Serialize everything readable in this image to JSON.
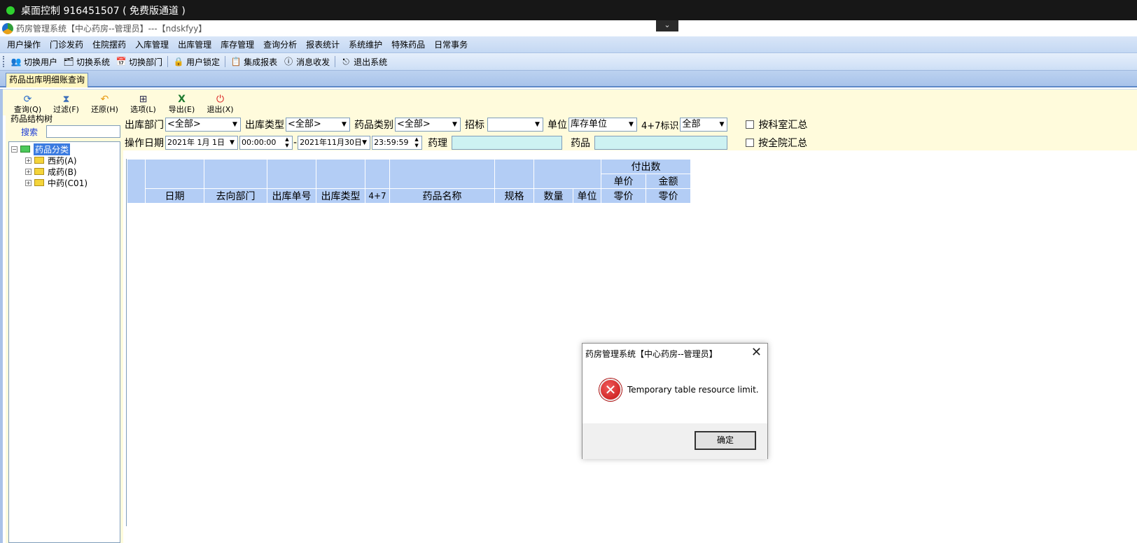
{
  "remote_bar": {
    "title": "桌面控制 916451507 ( 免费版通道 )",
    "chevron": "⌄"
  },
  "window": {
    "title": "药房管理系统【中心药房--管理员】---【ndskfyy】"
  },
  "menu": [
    "用户操作",
    "门诊发药",
    "住院摆药",
    "入库管理",
    "出库管理",
    "库存管理",
    "查询分析",
    "报表统计",
    "系统维护",
    "特殊药品",
    "日常事务"
  ],
  "toolbar": {
    "switch_user": "切换用户",
    "switch_system": "切换系统",
    "switch_dept": "切换部门",
    "user_lock": "用户锁定",
    "integrated_report": "集成报表",
    "messages": "消息收发",
    "exit_system": "退出系统"
  },
  "tab": {
    "label": "药品出库明细账查询"
  },
  "iconbar": {
    "query": "查询(Q)",
    "filter": "过滤(F)",
    "restore": "还原(H)",
    "options": "选项(L)",
    "export": "导出(E)",
    "exit": "退出(X)"
  },
  "left_panel": {
    "title": "药品结构树",
    "search_label": "搜索",
    "search_value": "",
    "tree_root": "药品分类",
    "tree_children": [
      "西药(A)",
      "成药(B)",
      "中药(C01)"
    ]
  },
  "filters": {
    "out_dept_label": "出库部门",
    "out_dept_value": "<全部>",
    "out_type_label": "出库类型",
    "out_type_value": "<全部>",
    "drug_cat_label": "药品类别",
    "drug_cat_value": "<全部>",
    "bid_label": "招标",
    "bid_value": "",
    "unit_label": "单位",
    "unit_value": "库存单位",
    "tag47_label": "4+7标识",
    "tag47_value": "全部",
    "by_dept_label": "按科室汇总",
    "op_date_label": "操作日期",
    "date_from": "2021年 1月 1日",
    "time_from": "00:00:00",
    "dash": "-",
    "date_to": "2021年11月30日",
    "time_to": "23:59:59",
    "pharm_label": "药理",
    "drug_label": "药品",
    "by_hosp_label": "按全院汇总"
  },
  "grid": {
    "group_header": "付出数",
    "sub_price": "单价",
    "sub_amount": "金额",
    "columns": [
      "日期",
      "去向部门",
      "出库单号",
      "出库类型",
      "4+7",
      "药品名称",
      "规格",
      "数量",
      "单位",
      "零价",
      "零价"
    ]
  },
  "dialog": {
    "title": "药房管理系统【中心药房--管理员】",
    "close": "✕",
    "message": "Temporary table resource limit.",
    "ok": "确定"
  }
}
